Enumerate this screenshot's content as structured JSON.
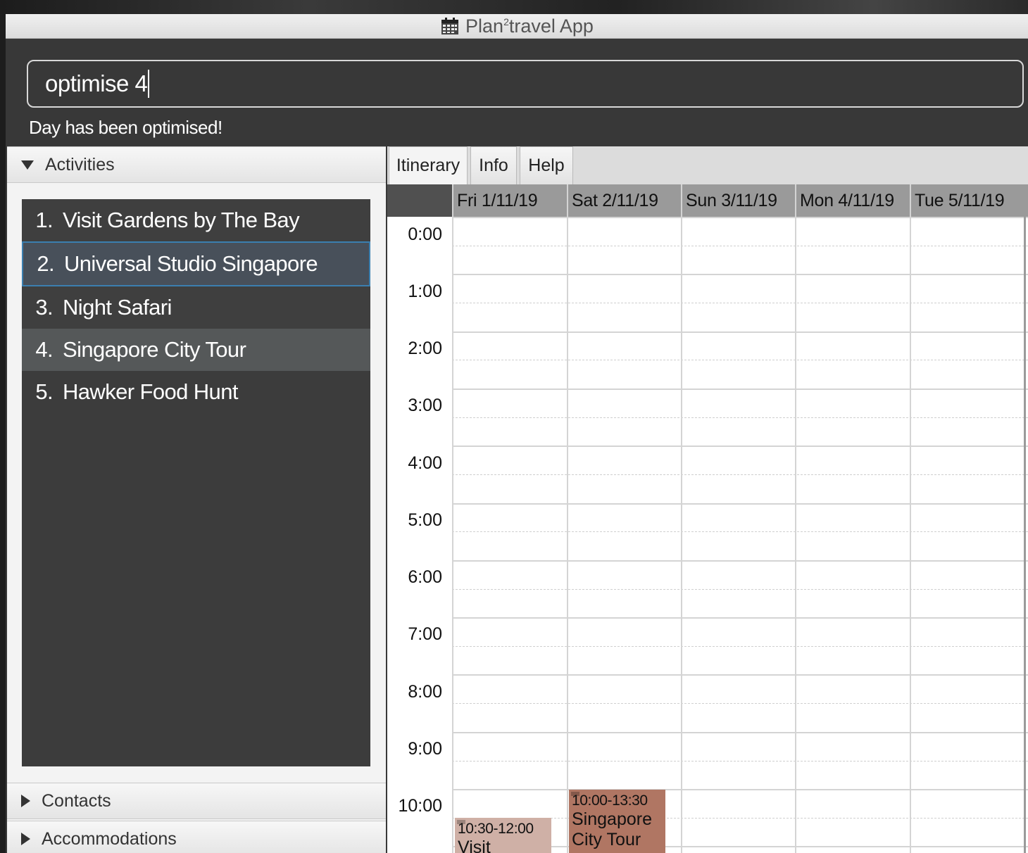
{
  "window": {
    "title_main": "Plan",
    "title_sup": "2",
    "title_rest": "travel App",
    "icon": "calendar-icon"
  },
  "command": {
    "value": "optimise 4"
  },
  "result": {
    "text": "Day has been optimised!"
  },
  "panels": {
    "activities": {
      "label": "Activities",
      "expanded": true
    },
    "contacts": {
      "label": "Contacts",
      "expanded": false
    },
    "accommodations": {
      "label": "Accommodations",
      "expanded": false
    }
  },
  "activities": [
    {
      "num": "1.",
      "name": "Visit Gardens by The Bay"
    },
    {
      "num": "2.",
      "name": "Universal Studio Singapore"
    },
    {
      "num": "3.",
      "name": "Night Safari"
    },
    {
      "num": "4.",
      "name": "Singapore City Tour"
    },
    {
      "num": "5.",
      "name": "Hawker Food Hunt"
    }
  ],
  "tabs": [
    {
      "label": "Itinerary",
      "selected": true
    },
    {
      "label": "Info",
      "selected": false
    },
    {
      "label": "Help",
      "selected": false
    }
  ],
  "calendar": {
    "days": [
      "Fri 1/11/19",
      "Sat 2/11/19",
      "Sun 3/11/19",
      "Mon 4/11/19",
      "Tue 5/11/19"
    ],
    "hours": [
      "0:00",
      "1:00",
      "2:00",
      "3:00",
      "4:00",
      "5:00",
      "6:00",
      "7:00",
      "8:00",
      "9:00",
      "10:00"
    ],
    "events": [
      {
        "time": "10:30-12:00",
        "title": "Visit Gardens",
        "day": "Fri 1/11/19",
        "color": "#cfb0a6"
      },
      {
        "time": "10:00-13:30",
        "title": "Singapore City Tour",
        "day": "Sat 2/11/19",
        "color": "#b07663"
      }
    ]
  },
  "colors": {
    "selected_item_border": "#3b7fb0",
    "selected_item_bg": "#48505a"
  }
}
